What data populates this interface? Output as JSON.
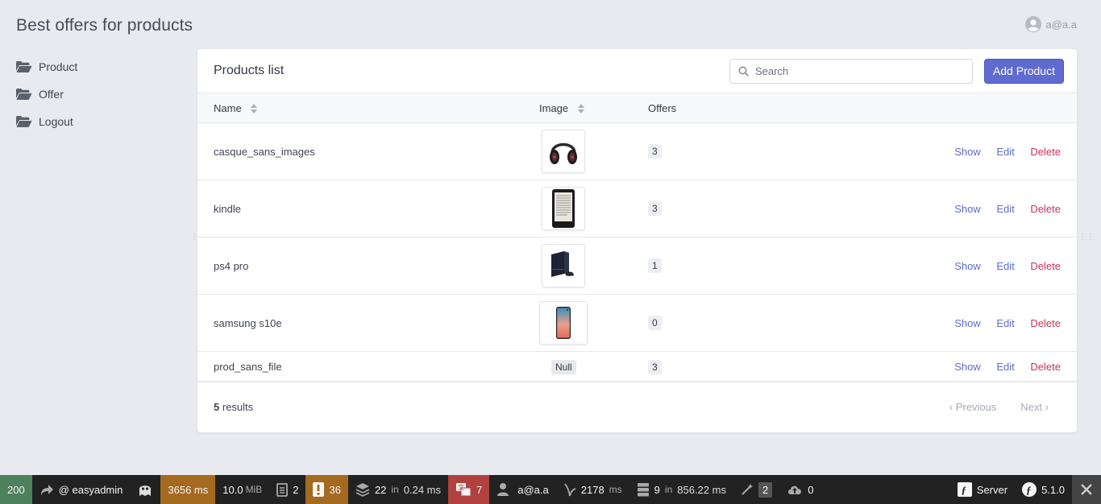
{
  "header": {
    "brand": "Best offers for products",
    "user_email": "a@a.a"
  },
  "sidebar": {
    "items": [
      {
        "label": "Product"
      },
      {
        "label": "Offer"
      },
      {
        "label": "Logout"
      }
    ]
  },
  "products": {
    "title": "Products list",
    "search_placeholder": "Search",
    "add_label": "Add Product",
    "columns": {
      "name": "Name",
      "image": "Image",
      "offers": "Offers"
    },
    "rows": [
      {
        "name": "casque_sans_images",
        "image": "headphones",
        "offers": "3",
        "show": "Show",
        "edit": "Edit",
        "delete": "Delete"
      },
      {
        "name": "kindle",
        "image": "kindle",
        "offers": "3",
        "show": "Show",
        "edit": "Edit",
        "delete": "Delete"
      },
      {
        "name": "ps4 pro",
        "image": "ps4",
        "offers": "1",
        "show": "Show",
        "edit": "Edit",
        "delete": "Delete"
      },
      {
        "name": "samsung s10e",
        "image": "phone",
        "offers": "0",
        "show": "Show",
        "edit": "Edit",
        "delete": "Delete"
      },
      {
        "name": "prod_sans_file",
        "image_text": "Null",
        "offers": "3",
        "show": "Show",
        "edit": "Edit",
        "delete": "Delete"
      }
    ],
    "results_count": "5",
    "results_label": "results",
    "pager": {
      "previous": "Previous",
      "next": "Next"
    }
  },
  "toolbar": {
    "status": "200",
    "route": "@ easyadmin",
    "time": "3656 ms",
    "memory_value": "10.0",
    "memory_unit": "MiB",
    "logs": "2",
    "warnings": "36",
    "cache": "22",
    "cache_in": "in",
    "cache_time": "0.24 ms",
    "translations": "7",
    "user": "a@a.a",
    "twig": "2178",
    "twig_unit": "ms",
    "db_queries": "9",
    "db_in": "in",
    "db_time": "856.22 ms",
    "forms": "2",
    "uploads": "0",
    "server_label": "Server",
    "symfony_version": "5.1.0"
  },
  "colors": {
    "accent": "#5f6bcf",
    "danger": "#c7325a",
    "status_ok": "#4f805d",
    "toolbar_warning": "#a46a1f",
    "toolbar_error": "#b0413e"
  }
}
